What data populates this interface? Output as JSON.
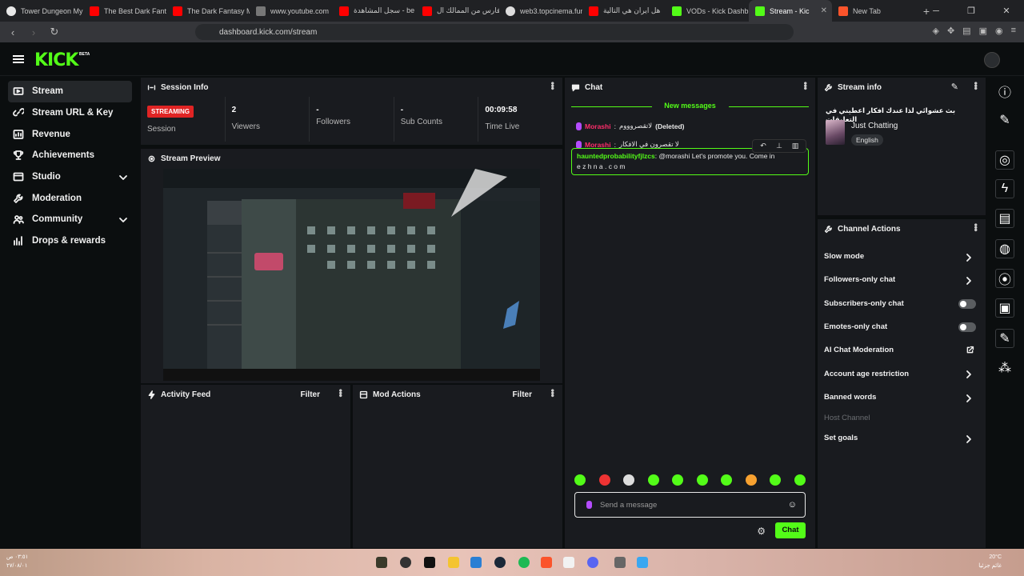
{
  "browser": {
    "tabs": [
      {
        "label": "Tower Dungeon My",
        "color": "#e8e8e8"
      },
      {
        "label": "The Best Dark Fanta",
        "color": "#ff0000"
      },
      {
        "label": "The Dark Fantasy M",
        "color": "#ff0000"
      },
      {
        "label": "www.youtube.com",
        "color": "#aaaaaa"
      },
      {
        "label": "سجل المشاهدة - be",
        "color": "#ff0000"
      },
      {
        "label": "فارس من الممالك ال",
        "color": "#ff0000"
      },
      {
        "label": "web3.topcinema.fun",
        "color": "#dddddd"
      },
      {
        "label": "هل ايران هي التالية",
        "color": "#ff0000"
      },
      {
        "label": "VODs - Kick Dashb",
        "color": "#53fc18"
      },
      {
        "label": "Stream - Kic",
        "color": "#53fc18",
        "active": true
      },
      {
        "label": "New Tab",
        "color": "#fb542b"
      }
    ],
    "url": "dashboard.kick.com/stream"
  },
  "brand": {
    "logo": "KICK",
    "beta": "BETA",
    "accent": "#53fc18"
  },
  "sidebar": {
    "items": [
      {
        "label": "Stream",
        "icon": "stream-icon"
      },
      {
        "label": "Stream URL & Key",
        "icon": "link-icon"
      },
      {
        "label": "Revenue",
        "icon": "revenue-icon"
      },
      {
        "label": "Achievements",
        "icon": "trophy-icon"
      },
      {
        "label": "Studio",
        "icon": "studio-icon"
      },
      {
        "label": "Moderation",
        "icon": "wrench-icon"
      },
      {
        "label": "Community",
        "icon": "community-icon"
      },
      {
        "label": "Drops & rewards",
        "icon": "drops-icon"
      }
    ]
  },
  "session": {
    "title": "Session Info",
    "status": "STREAMING",
    "status_label": "Session",
    "viewers": "2",
    "viewers_label": "Viewers",
    "followers": "-",
    "followers_label": "Followers",
    "subs": "-",
    "subs_label": "Sub Counts",
    "time": "00:09:58",
    "time_label": "Time Live"
  },
  "preview": {
    "title": "Stream Preview"
  },
  "activity": {
    "title": "Activity Feed",
    "filter": "Filter"
  },
  "mod_actions": {
    "title": "Mod Actions",
    "filter": "Filter"
  },
  "chat": {
    "title": "Chat",
    "new_messages": "New messages",
    "messages": [
      {
        "user": "Morashi",
        "text": "لاتقصروووم",
        "suffix": "(Deleted)"
      },
      {
        "user": "Morashi",
        "text": "لا تقصرون في الافكار",
        "suffix": ""
      }
    ],
    "highlight": {
      "user": "hauntedprobabilityfjlzcs",
      "text": "@morashi Let's promote you. Come in",
      "line2": "e z h n a . c o m"
    },
    "placeholder": "Send a message",
    "send": "Chat"
  },
  "stream_info": {
    "title": "Stream info",
    "stream_title": "بث عشوائي لذا عندك افكار اعطيني في التعليقات",
    "category": "Just Chatting",
    "language": "English"
  },
  "channel_actions": {
    "title": "Channel Actions",
    "items": [
      {
        "label": "Slow mode",
        "kind": "arrow"
      },
      {
        "label": "Followers-only chat",
        "kind": "arrow"
      },
      {
        "label": "Subscribers-only chat",
        "kind": "toggle"
      },
      {
        "label": "Emotes-only chat",
        "kind": "toggle"
      },
      {
        "label": "AI Chat Moderation",
        "kind": "external"
      },
      {
        "label": "Account age restriction",
        "kind": "arrow"
      },
      {
        "label": "Banned words",
        "kind": "arrow"
      },
      {
        "label": "Host Channel",
        "kind": "disabled"
      },
      {
        "label": "Set goals",
        "kind": "arrow"
      }
    ]
  },
  "taskbar": {
    "left_time": "٠٣:٥١ ص",
    "left_date": "٢٧/٠٨/٠١",
    "right_temp": "20°C",
    "right_text": "غائم جزئيا"
  }
}
